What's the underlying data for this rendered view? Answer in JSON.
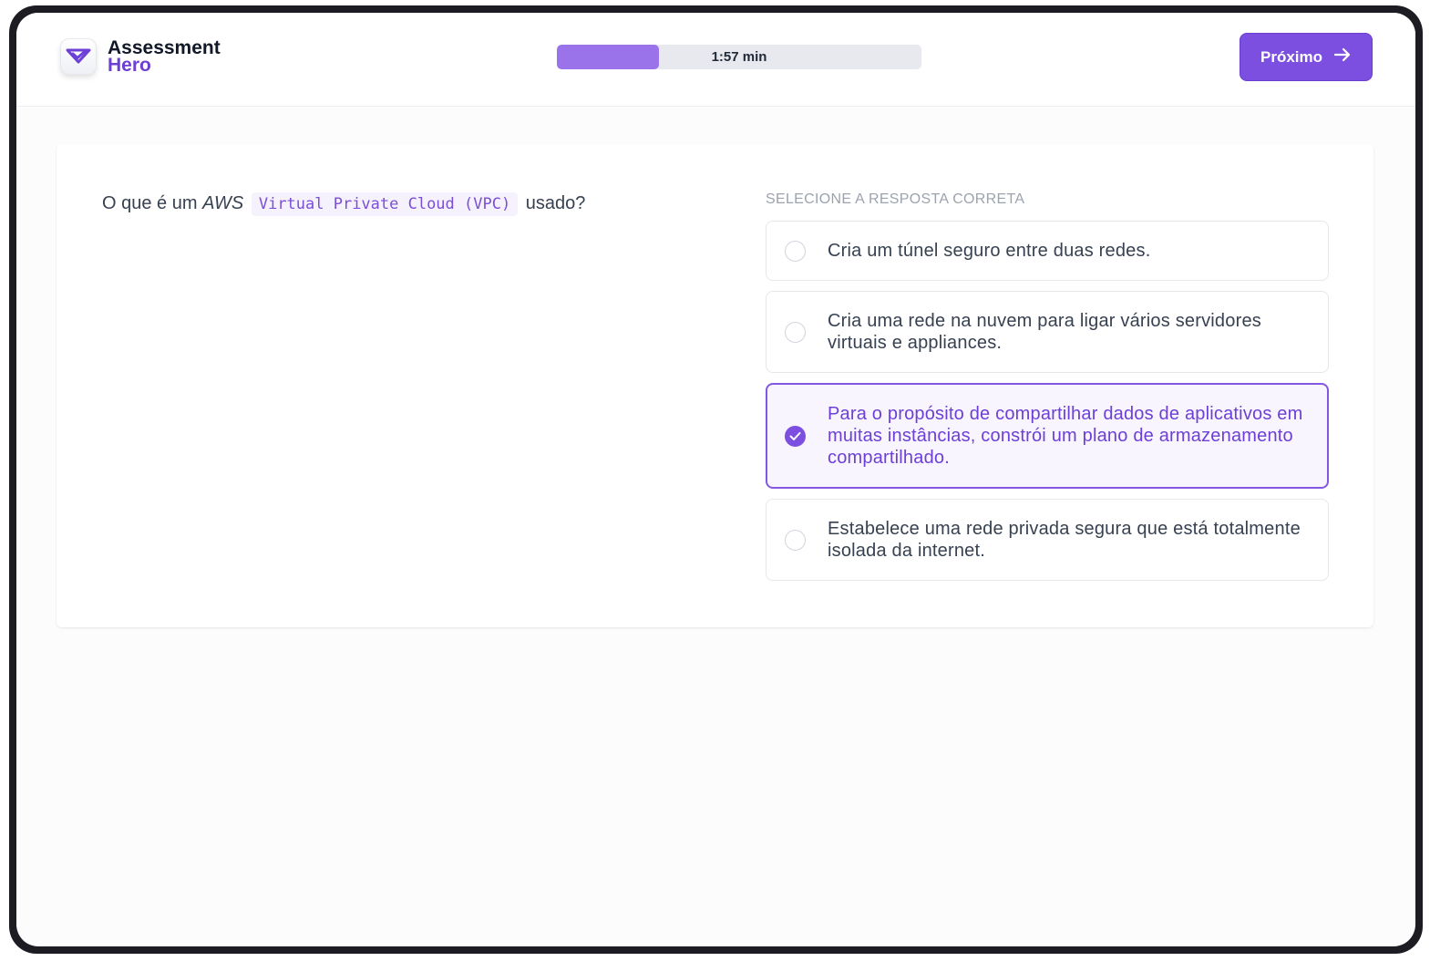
{
  "app": {
    "logo_line1": "Assessment",
    "logo_line2": "Hero"
  },
  "timer": {
    "label": "1:57 min",
    "progress_fraction": 0.28
  },
  "toolbar": {
    "next_label": "Próximo"
  },
  "question": {
    "prefix": "O que é um",
    "emphasis": "AWS",
    "code": "Virtual Private Cloud (VPC)",
    "suffix": "usado?"
  },
  "answers": {
    "label": "SELECIONE A RESPOSTA CORRETA",
    "options": [
      {
        "text": "Cria um túnel seguro entre duas redes.",
        "selected": false
      },
      {
        "text": "Cria uma rede na nuvem para ligar vários servidores virtuais e appliances.",
        "selected": false
      },
      {
        "text": "Para o propósito de compartilhar dados de aplicativos em muitas instâncias, constrói um plano de armazenamento compartilhado.",
        "selected": true
      },
      {
        "text": "Estabelece uma rede privada segura que está totalmente isolada da internet.",
        "selected": false
      }
    ]
  },
  "colors": {
    "accent": "#7c4fe0",
    "accent_text": "#6d3fd6",
    "timer_fill": "#9a73ea",
    "selected_bg": "#f8f5fe"
  },
  "icons": {
    "logo": "chevron-check-logo-icon",
    "next": "arrow-right-icon",
    "selected": "check-icon"
  }
}
